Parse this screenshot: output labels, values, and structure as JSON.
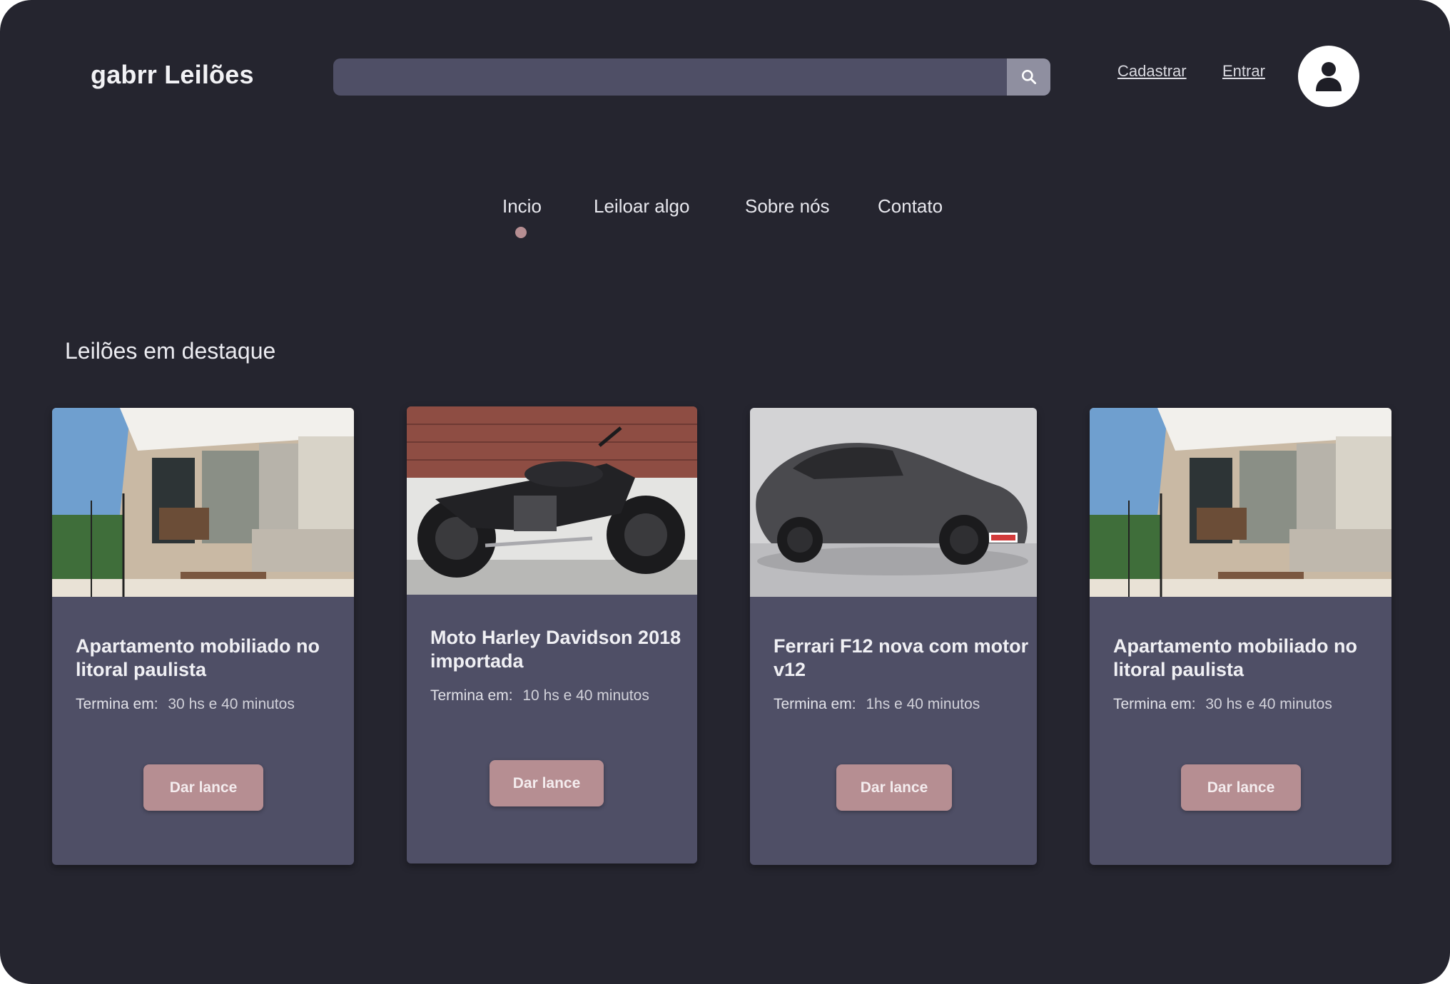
{
  "header": {
    "logo": "gabrr Leilões",
    "search_placeholder": "",
    "signup_label": "Cadastrar",
    "login_label": "Entrar"
  },
  "nav": {
    "items": [
      {
        "label": "Incio",
        "active": true
      },
      {
        "label": "Leiloar algo",
        "active": false
      },
      {
        "label": "Sobre nós",
        "active": false
      },
      {
        "label": "Contato",
        "active": false
      }
    ]
  },
  "featured": {
    "title": "Leilões em destaque",
    "cards": [
      {
        "image": "apartment-balcony-image",
        "title": "Apartamento mobiliado no litoral paulista",
        "ends_label": "Termina em:",
        "ends_value": "30 hs e 40 minutos",
        "button": "Dar lance"
      },
      {
        "image": "motorcycle-image",
        "title": "Moto Harley Davidson 2018 importada",
        "ends_label": "Termina em:",
        "ends_value": "10 hs e 40 minutos",
        "button": "Dar lance"
      },
      {
        "image": "sports-car-image",
        "title": "Ferrari F12 nova com motor v12",
        "ends_label": "Termina em:",
        "ends_value": "1hs e 40 minutos",
        "button": "Dar lance"
      },
      {
        "image": "apartment-balcony-image",
        "title": "Apartamento mobiliado no litoral paulista",
        "ends_label": "Termina em:",
        "ends_value": "30 hs e 40 minutos",
        "button": "Dar lance"
      }
    ]
  },
  "colors": {
    "background": "#25252f",
    "surface": "#4f4f66",
    "accent": "#b68e92",
    "search_button": "#8f8fa0"
  }
}
